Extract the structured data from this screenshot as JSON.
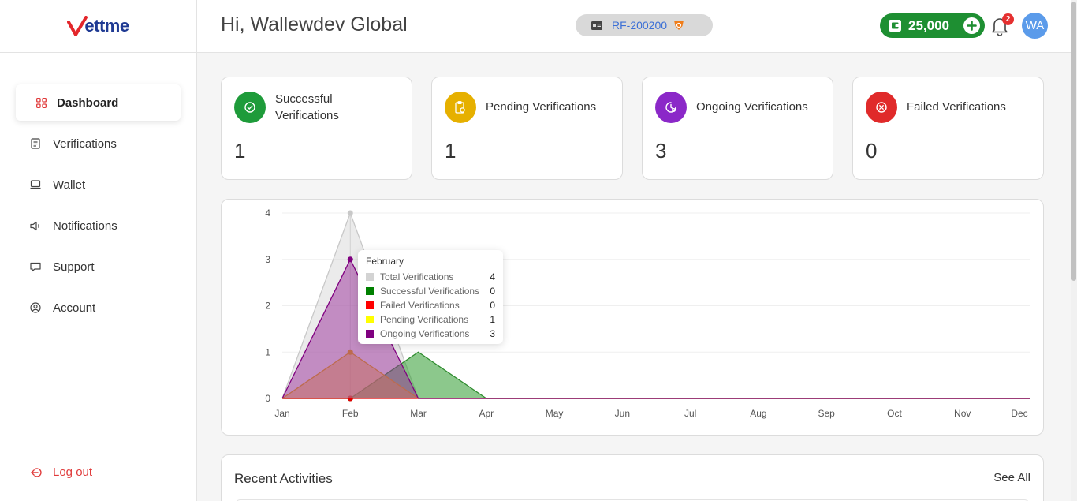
{
  "app": {
    "logo_text": "ettme"
  },
  "sidebar": {
    "items": [
      {
        "label": "Dashboard",
        "icon": "grid-icon",
        "active": true
      },
      {
        "label": "Verifications",
        "icon": "document-icon"
      },
      {
        "label": "Wallet",
        "icon": "laptop-icon"
      },
      {
        "label": "Notifications",
        "icon": "speaker-icon"
      },
      {
        "label": "Support",
        "icon": "chat-icon"
      },
      {
        "label": "Account",
        "icon": "user-circle-icon"
      }
    ],
    "logout_label": "Log out"
  },
  "header": {
    "greeting": "Hi, Wallewdev Global",
    "reference_id": "RF-200200",
    "wallet_balance": "25,000",
    "notification_count": "2",
    "avatar_initials": "WA"
  },
  "stats": [
    {
      "label": "Successful Verifications",
      "value": "1",
      "color": "#1e9b3a",
      "icon": "check-circle-icon"
    },
    {
      "label": "Pending Verifications",
      "value": "1",
      "color": "#e6b000",
      "icon": "clipboard-clock-icon"
    },
    {
      "label": "Ongoing Verifications",
      "value": "3",
      "color": "#8b28c8",
      "icon": "progress-clock-icon"
    },
    {
      "label": "Failed Verifications",
      "value": "0",
      "color": "#e02a2a",
      "icon": "x-circle-icon"
    }
  ],
  "chart_data": {
    "type": "area",
    "x": [
      "Jan",
      "Feb",
      "Mar",
      "Apr",
      "May",
      "Jun",
      "Jul",
      "Aug",
      "Sep",
      "Oct",
      "Nov",
      "Dec"
    ],
    "ylim": [
      0,
      4
    ],
    "yticks": [
      "0",
      "1",
      "2",
      "3",
      "4"
    ],
    "grid": true,
    "series": [
      {
        "name": "Total Verifications",
        "color": "#d3d3d3",
        "values": [
          0,
          4,
          0,
          0,
          0,
          0,
          0,
          0,
          0,
          0,
          0,
          0
        ]
      },
      {
        "name": "Successful Verifications",
        "color": "#0a8a0a",
        "values": [
          0,
          0,
          1,
          0,
          0,
          0,
          0,
          0,
          0,
          0,
          0,
          0
        ]
      },
      {
        "name": "Failed Verifications",
        "color": "#ff0000",
        "values": [
          0,
          0,
          0,
          0,
          0,
          0,
          0,
          0,
          0,
          0,
          0,
          0
        ]
      },
      {
        "name": "Pending Verifications",
        "color": "#ffff00",
        "values": [
          0,
          1,
          0,
          0,
          0,
          0,
          0,
          0,
          0,
          0,
          0,
          0
        ]
      },
      {
        "name": "Ongoing Verifications",
        "color": "#800080",
        "values": [
          0,
          3,
          0,
          0,
          0,
          0,
          0,
          0,
          0,
          0,
          0,
          0
        ]
      }
    ],
    "tooltip": {
      "title": "February",
      "rows": [
        {
          "name": "Total Verifications",
          "value": "4",
          "color": "#d3d3d3"
        },
        {
          "name": "Successful Verifications",
          "value": "0",
          "color": "#008000"
        },
        {
          "name": "Failed Verifications",
          "value": "0",
          "color": "#ff0000"
        },
        {
          "name": "Pending Verifications",
          "value": "1",
          "color": "#ffff00"
        },
        {
          "name": "Ongoing Verifications",
          "value": "3",
          "color": "#800080"
        }
      ]
    }
  },
  "activities": {
    "title": "Recent Activities",
    "see_all": "See All"
  }
}
